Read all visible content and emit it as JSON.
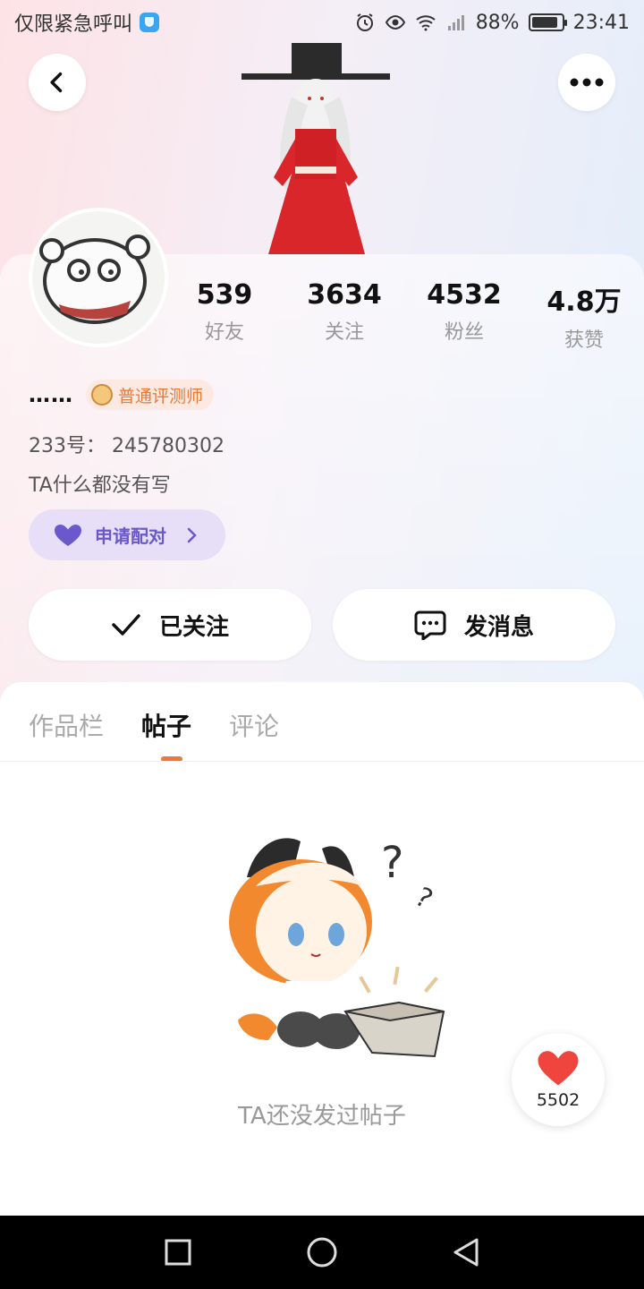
{
  "status_bar": {
    "left_text": "仅限紧急呼叫",
    "battery": "88%",
    "time": "23:41",
    "icons": [
      "alarm-icon",
      "eye-icon",
      "wifi-icon",
      "signal-icon",
      "battery-icon"
    ]
  },
  "header": {
    "back_icon": "chevron-left-icon",
    "more_icon": "more-dots-icon"
  },
  "profile": {
    "stats": [
      {
        "value": "539",
        "label": "好友"
      },
      {
        "value": "3634",
        "label": "关注"
      },
      {
        "value": "4532",
        "label": "粉丝"
      },
      {
        "value": "4.8万",
        "label": "获赞"
      }
    ],
    "nickname": "……",
    "badge": "普通评测师",
    "uid": "233号：  245780302",
    "bio": "TA什么都没有写",
    "pair_button": "申请配对"
  },
  "actions": {
    "follow_label": "已关注",
    "message_label": "发消息"
  },
  "tabs": [
    {
      "label": "作品栏",
      "active": false
    },
    {
      "label": "帖子",
      "active": true
    },
    {
      "label": "评论",
      "active": false
    }
  ],
  "empty_state": {
    "text": "TA还没发过帖子"
  },
  "like_fab": {
    "count": "5502"
  },
  "colors": {
    "accent_orange": "#f2753a",
    "pair_purple": "#6b58cc",
    "heart_red": "#f0453f"
  }
}
